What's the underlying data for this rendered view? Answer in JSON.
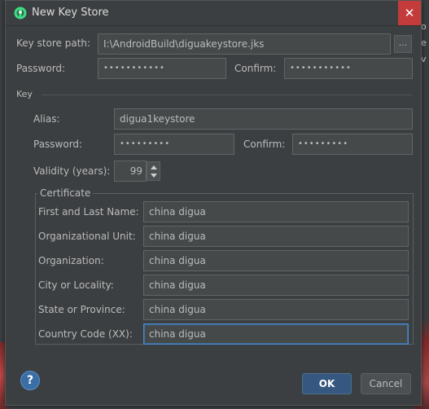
{
  "dialog": {
    "title": "New Key Store",
    "close_glyph": "✕"
  },
  "keystore": {
    "path_label": "Key store path:",
    "path_value": "I:\\AndroidBuild\\diguakeystore.jks",
    "browse_label": "...",
    "password_label": "Password:",
    "password_value": "•••••••••••",
    "confirm_label": "Confirm:",
    "confirm_value": "•••••••••••"
  },
  "key": {
    "section_label": "Key",
    "alias_label": "Alias:",
    "alias_value": "digua1keystore",
    "password_label": "Password:",
    "password_value": "•••••••••",
    "confirm_label": "Confirm:",
    "confirm_value": "•••••••••",
    "validity_label": "Validity (years):",
    "validity_value": "99"
  },
  "certificate": {
    "legend": "Certificate",
    "fields": [
      {
        "label": "First and Last Name:",
        "value": "china digua"
      },
      {
        "label": "Organizational Unit:",
        "value": "china digua"
      },
      {
        "label": "Organization:",
        "value": "china digua"
      },
      {
        "label": "City or Locality:",
        "value": "china digua"
      },
      {
        "label": "State or Province:",
        "value": "china digua"
      },
      {
        "label": "Country Code (XX):",
        "value": "china digua"
      }
    ]
  },
  "footer": {
    "help_glyph": "?",
    "ok_label": "OK",
    "cancel_label": "Cancel"
  },
  "background": {
    "right_text_1": "o",
    "right_text_2": "e",
    "right_text_3": "v"
  },
  "colors": {
    "accent": "#365880",
    "close": "#c43b3b",
    "focus": "#4a88c7",
    "background": "#3c3f41"
  }
}
